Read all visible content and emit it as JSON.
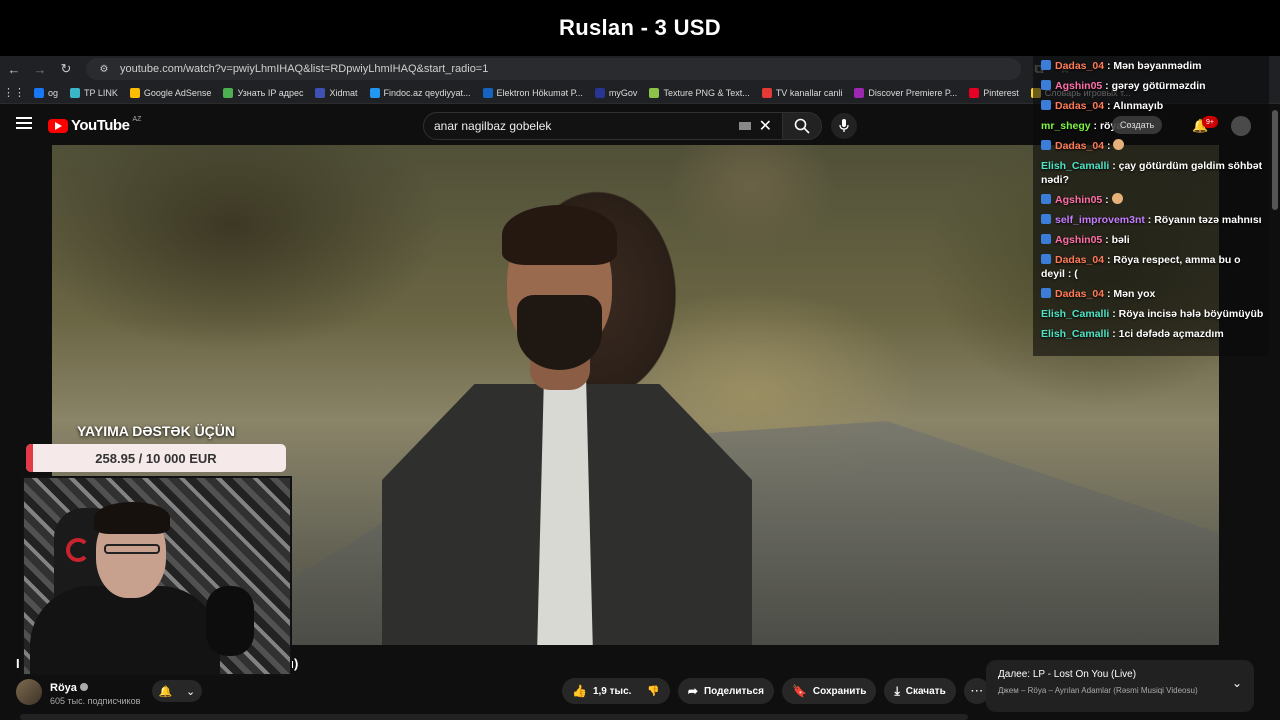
{
  "stream": {
    "title": "Ruslan - 3 USD"
  },
  "browser": {
    "url": "youtube.com/watch?v=pwiyLhmIHAQ&list=RDpwiyLhmIHAQ&start_radio=1",
    "bookmarks": [
      {
        "label": "og",
        "color": "#1877f2"
      },
      {
        "label": "TP LINK",
        "color": "#3bb6c6"
      },
      {
        "label": "Google AdSense",
        "color": "#fbbc04"
      },
      {
        "label": "Узнать IP адрес",
        "color": "#4caf50"
      },
      {
        "label": "Xidmat",
        "color": "#3f51b5"
      },
      {
        "label": "Findoc.az qeydiyyat...",
        "color": "#2196f3"
      },
      {
        "label": "Elektron Hökumət P...",
        "color": "#1565c0"
      },
      {
        "label": "myGov",
        "color": "#283593"
      },
      {
        "label": "Texture PNG & Text...",
        "color": "#8bc34a"
      },
      {
        "label": "TV kanallar canli",
        "color": "#e53935"
      },
      {
        "label": "Discover Premiere P...",
        "color": "#9c27b0"
      },
      {
        "label": "Pinterest",
        "color": "#e60023"
      },
      {
        "label": "Словарь игровых т...",
        "color": "#fdd835"
      }
    ]
  },
  "youtube": {
    "logo_text": "YouTube",
    "region": "AZ",
    "search_value": "anar nagilbaz gobelek",
    "notifications": "9+",
    "create_label": "Создать"
  },
  "video": {
    "title_start": "I",
    "title_end": "u)",
    "channel_name": "Röya",
    "subscribers": "605 тыс. подписчиков",
    "likes": "1,9 тыс.",
    "share_label": "Поделиться",
    "save_label": "Сохранить",
    "download_label": "Скачать"
  },
  "next_up": {
    "title": "Далее: LP - Lost On You (Live)",
    "subtitle": "Джем – Röya – Ayrılan Adamlar (Rəsmi Musiqi Videosu)"
  },
  "donation": {
    "label": "YAYIMA DƏSTƏK ÜÇÜN",
    "amount_text": "258.95 / 10 000 EUR",
    "progress": 0.026,
    "fill_color": "#e23a46"
  },
  "chat": [
    {
      "user": "Dadas_04",
      "color": "#ff7a59",
      "badge": true,
      "text": "Mən bəyanmədim"
    },
    {
      "user": "Agshin05",
      "color": "#ff6fa8",
      "badge": true,
      "text": "gərəy götürməzdin"
    },
    {
      "user": "Dadas_04",
      "color": "#ff7a59",
      "badge": true,
      "text": "Alınmayıb"
    },
    {
      "user": "mr_shegy",
      "color": "#7bf542",
      "badge": false,
      "text": "röya ♥"
    },
    {
      "user": "Dadas_04",
      "color": "#ff7a59",
      "badge": true,
      "text": "",
      "emoji": true
    },
    {
      "user": "Elish_Camalli",
      "color": "#4de3c4",
      "badge": false,
      "text": "çay götürdüm gəldim söhbət nədi?"
    },
    {
      "user": "Agshin05",
      "color": "#ff6fa8",
      "badge": true,
      "text": "",
      "emoji": true
    },
    {
      "user": "self_improvem3nt",
      "color": "#c77dff",
      "badge": true,
      "text": "Röyanın təzə mahnısı"
    },
    {
      "user": "Agshin05",
      "color": "#ff6fa8",
      "badge": true,
      "text": "bəli"
    },
    {
      "user": "Dadas_04",
      "color": "#ff7a59",
      "badge": true,
      "text": "Röya respect, amma bu o deyil : ("
    },
    {
      "user": "Dadas_04",
      "color": "#ff7a59",
      "badge": true,
      "text": "Mən yox"
    },
    {
      "user": "Elish_Camalli",
      "color": "#4de3c4",
      "badge": false,
      "text": "Röya incisə hələ böyümüyüb"
    },
    {
      "user": "Elish_Camalli",
      "color": "#4de3c4",
      "badge": false,
      "text": "1ci dəfədə açmazdım"
    }
  ]
}
